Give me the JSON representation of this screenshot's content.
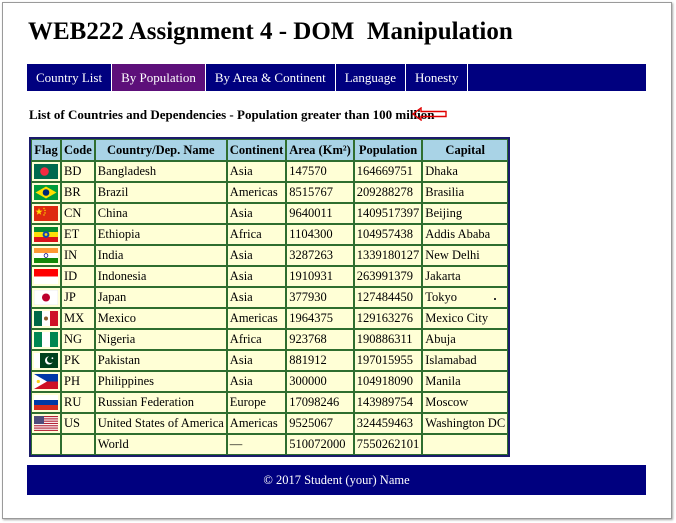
{
  "page_title": "WEB222 Assignment 4 - DOM  Manipulation",
  "nav": [
    {
      "label": "Country List",
      "active": false
    },
    {
      "label": "By Population",
      "active": true
    },
    {
      "label": "By Area & Continent",
      "active": false
    },
    {
      "label": "Language",
      "active": false
    },
    {
      "label": "Honesty",
      "active": false
    }
  ],
  "subtitle": "List of Countries and Dependencies - Population greater than 100 million",
  "table": {
    "headers": [
      "Flag",
      "Code",
      "Country/Dep. Name",
      "Continent",
      "Area (Km²)",
      "Population",
      "Capital"
    ],
    "rows": [
      {
        "flag": "bangladesh-flag-icon",
        "code": "BD",
        "name": "Bangladesh",
        "continent": "Asia",
        "area": "147570",
        "population": "164669751",
        "capital": "Dhaka"
      },
      {
        "flag": "brazil-flag-icon",
        "code": "BR",
        "name": "Brazil",
        "continent": "Americas",
        "area": "8515767",
        "population": "209288278",
        "capital": "Brasilia"
      },
      {
        "flag": "china-flag-icon",
        "code": "CN",
        "name": "China",
        "continent": "Asia",
        "area": "9640011",
        "population": "1409517397",
        "capital": "Beijing"
      },
      {
        "flag": "ethiopia-flag-icon",
        "code": "ET",
        "name": "Ethiopia",
        "continent": "Africa",
        "area": "1104300",
        "population": "104957438",
        "capital": "Addis Ababa"
      },
      {
        "flag": "india-flag-icon",
        "code": "IN",
        "name": "India",
        "continent": "Asia",
        "area": "3287263",
        "population": "1339180127",
        "capital": "New Delhi"
      },
      {
        "flag": "indonesia-flag-icon",
        "code": "ID",
        "name": "Indonesia",
        "continent": "Asia",
        "area": "1910931",
        "population": "263991379",
        "capital": "Jakarta"
      },
      {
        "flag": "japan-flag-icon",
        "code": "JP",
        "name": "Japan",
        "continent": "Asia",
        "area": "377930",
        "population": "127484450",
        "capital": "Tokyo"
      },
      {
        "flag": "mexico-flag-icon",
        "code": "MX",
        "name": "Mexico",
        "continent": "Americas",
        "area": "1964375",
        "population": "129163276",
        "capital": "Mexico City"
      },
      {
        "flag": "nigeria-flag-icon",
        "code": "NG",
        "name": "Nigeria",
        "continent": "Africa",
        "area": "923768",
        "population": "190886311",
        "capital": "Abuja"
      },
      {
        "flag": "pakistan-flag-icon",
        "code": "PK",
        "name": "Pakistan",
        "continent": "Asia",
        "area": "881912",
        "population": "197015955",
        "capital": "Islamabad"
      },
      {
        "flag": "philippines-flag-icon",
        "code": "PH",
        "name": "Philippines",
        "continent": "Asia",
        "area": "300000",
        "population": "104918090",
        "capital": "Manila"
      },
      {
        "flag": "russia-flag-icon",
        "code": "RU",
        "name": "Russian Federation",
        "continent": "Europe",
        "area": "17098246",
        "population": "143989754",
        "capital": "Moscow"
      },
      {
        "flag": "usa-flag-icon",
        "code": "US",
        "name": "United States of America",
        "continent": "Americas",
        "area": "9525067",
        "population": "324459463",
        "capital": "Washington DC"
      },
      {
        "flag": "",
        "code": "",
        "name": "World",
        "continent": "—",
        "area": "510072000",
        "population": "7550262101",
        "capital": ""
      }
    ]
  },
  "footer": "© 2017 Student (your) Name",
  "colors": {
    "navbar": "#00007f",
    "nav_active": "#5d0f7a",
    "header_bg": "#a9d3e6",
    "cell_bg": "#ffffd6",
    "arrow": "#e00000"
  }
}
